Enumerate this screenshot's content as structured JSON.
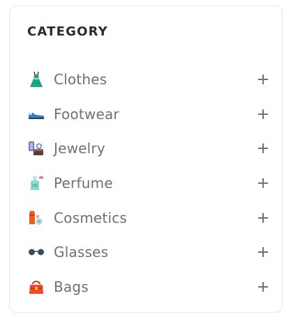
{
  "category": {
    "title": "CATEGORY",
    "items": [
      {
        "label": "Clothes",
        "icon": "dress-icon"
      },
      {
        "label": "Footwear",
        "icon": "shoe-icon"
      },
      {
        "label": "Jewelry",
        "icon": "jewelry-icon"
      },
      {
        "label": "Perfume",
        "icon": "perfume-icon"
      },
      {
        "label": "Cosmetics",
        "icon": "cosmetics-icon"
      },
      {
        "label": "Glasses",
        "icon": "glasses-icon"
      },
      {
        "label": "Bags",
        "icon": "bag-icon"
      }
    ],
    "expand_icon": "plus-icon",
    "colors": {
      "title": "#2b2b2b",
      "label": "#707070",
      "border": "#e6e6e6"
    }
  }
}
